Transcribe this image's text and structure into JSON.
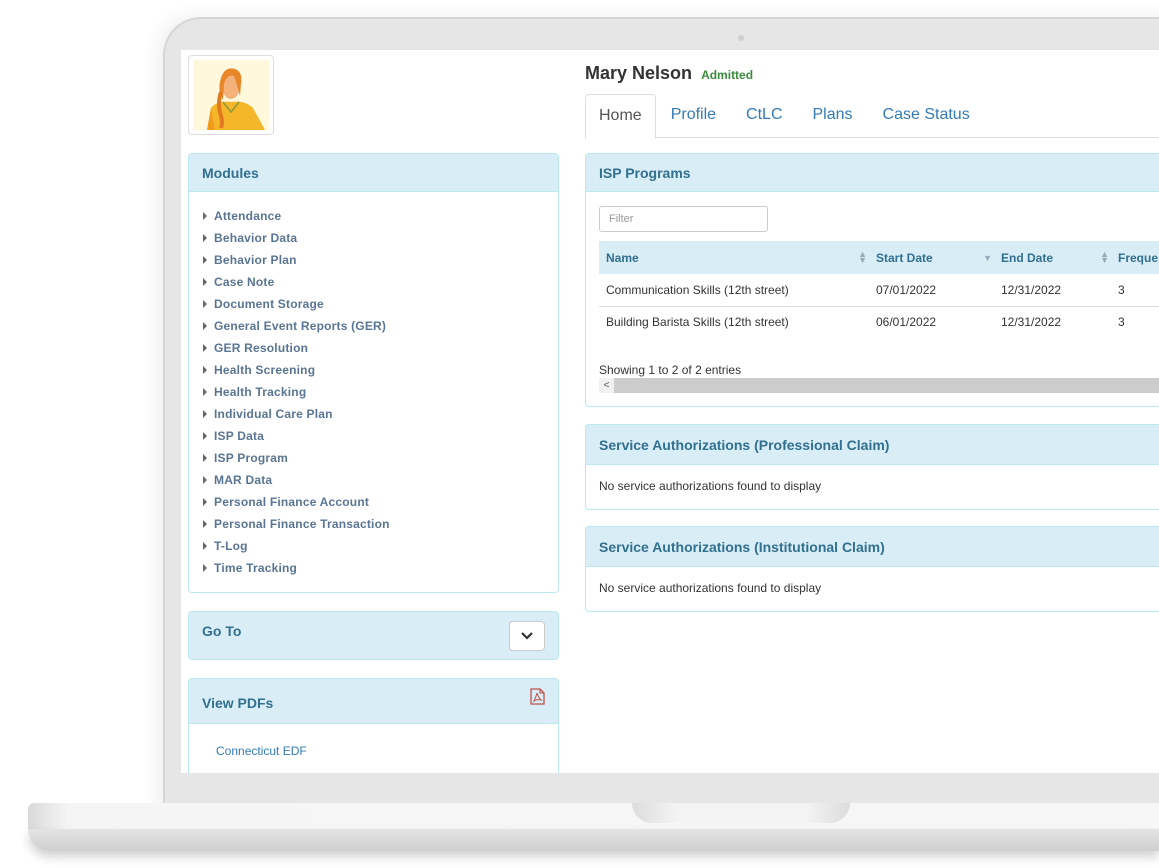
{
  "patient": {
    "name": "Mary Nelson",
    "status": "Admitted",
    "status_color": "#3c8b3c"
  },
  "tabs": [
    {
      "label": "Home",
      "active": true
    },
    {
      "label": "Profile",
      "active": false
    },
    {
      "label": "CtLC",
      "active": false
    },
    {
      "label": "Plans",
      "active": false
    },
    {
      "label": "Case Status",
      "active": false
    }
  ],
  "modules": {
    "title": "Modules",
    "items": [
      "Attendance",
      "Behavior Data",
      "Behavior Plan",
      "Case Note",
      "Document Storage",
      "General Event Reports (GER)",
      "GER Resolution",
      "Health Screening",
      "Health Tracking",
      "Individual Care Plan",
      "ISP Data",
      "ISP Program",
      "MAR Data",
      "Personal Finance Account",
      "Personal Finance Transaction",
      "T-Log",
      "Time Tracking"
    ]
  },
  "goto": {
    "title": "Go To",
    "icon": "chevron-down-icon"
  },
  "pdfs": {
    "title": "View PDFs",
    "icon": "pdf-file-icon",
    "links": [
      "Connecticut EDF"
    ]
  },
  "isp_programs": {
    "title": "ISP Programs",
    "filter_placeholder": "Filter",
    "columns": [
      "Name",
      "Start Date",
      "End Date",
      "Freque"
    ],
    "rows": [
      [
        "Communication Skills (12th street)",
        "07/01/2022",
        "12/31/2022",
        "3"
      ],
      [
        "Building Barista Skills (12th street)",
        "06/01/2022",
        "12/31/2022",
        "3"
      ]
    ],
    "showing": "Showing 1 to 2 of 2 entries",
    "scroll_left": "<"
  },
  "service_auth_professional": {
    "title": "Service Authorizations (Professional Claim)",
    "empty": "No service authorizations found to display"
  },
  "service_auth_institutional": {
    "title": "Service Authorizations (Institutional Claim)",
    "empty": "No service authorizations found to display"
  },
  "colors": {
    "panel_heading_bg": "#d9edf7",
    "panel_heading_text": "#31708f",
    "link": "#337ab7",
    "pdf_icon": "#c0504d"
  }
}
